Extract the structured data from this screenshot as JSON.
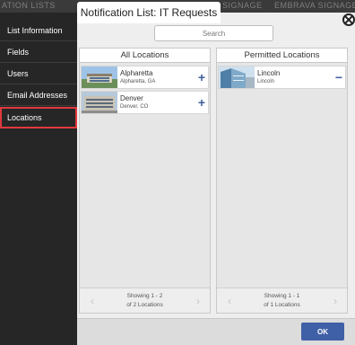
{
  "appbar": {
    "left_text": "ATION LISTS",
    "right_text_1": "SIGNAGE",
    "right_text_2": "EMBRAVA SIGNAGE"
  },
  "sidebar": {
    "items": [
      {
        "label": "List Information"
      },
      {
        "label": "Fields"
      },
      {
        "label": "Users"
      },
      {
        "label": "Email Addresses"
      },
      {
        "label": "Locations"
      }
    ],
    "active_item": "Locations"
  },
  "dialog": {
    "title": "Notification List: IT Requests",
    "search_placeholder": "Search",
    "ok_label": "OK"
  },
  "all_locations": {
    "title": "All Locations",
    "items": [
      {
        "name": "Alpharetta",
        "subtitle": "Alpharetta, GA",
        "action": "+"
      },
      {
        "name": "Denver",
        "subtitle": "Denver, CO",
        "action": "+"
      }
    ],
    "pager_line1": "Showing 1 - 2",
    "pager_line2": "of 2 Locations"
  },
  "permitted_locations": {
    "title": "Permitted Locations",
    "items": [
      {
        "name": "Lincoln",
        "subtitle": "Lincoln",
        "action": "−"
      }
    ],
    "pager_line1": "Showing 1 - 1",
    "pager_line2": "of 1 Locations"
  },
  "icons": {
    "close": "close-icon",
    "add": "plus-icon",
    "remove": "minus-icon",
    "prev": "chevron-left-icon",
    "next": "chevron-right-icon"
  },
  "colors": {
    "sidebar_bg": "#262626",
    "active_outline": "#e0393e",
    "accent": "#3f5e9c",
    "ok_button": "#3f5fa6"
  }
}
